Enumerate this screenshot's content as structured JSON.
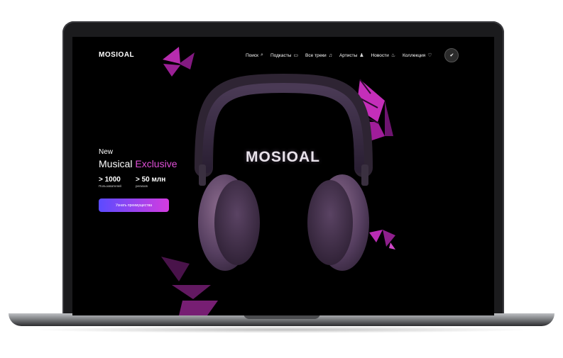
{
  "logo": "MOSIOAL",
  "nav": [
    {
      "label": "Поиск",
      "icon": "search-icon",
      "glyph": "⌕"
    },
    {
      "label": "Подкасты",
      "icon": "podcast-icon",
      "glyph": "▭"
    },
    {
      "label": "Все треки",
      "icon": "headphones-icon",
      "glyph": "♫"
    },
    {
      "label": "Артисты",
      "icon": "artists-icon",
      "glyph": "♟"
    },
    {
      "label": "Новости",
      "icon": "fire-icon",
      "glyph": "♨"
    },
    {
      "label": "Коллекция",
      "icon": "heart-icon",
      "glyph": "♡"
    }
  ],
  "profile_glyph": "✔",
  "hero": {
    "eyebrow": "New",
    "title_main": "Musical ",
    "title_accent": "Exclusive",
    "stats": [
      {
        "value": "> 1000",
        "label": "Пользователей"
      },
      {
        "value": "> 50 млн",
        "label": "релизов"
      }
    ],
    "cta": "Узнать преимущества"
  },
  "brand_word": "MOSIOAL",
  "colors": {
    "accent": "#e04fd8",
    "gradient_start": "#5b4bff",
    "gradient_end": "#d43ce0",
    "background": "#000000"
  }
}
